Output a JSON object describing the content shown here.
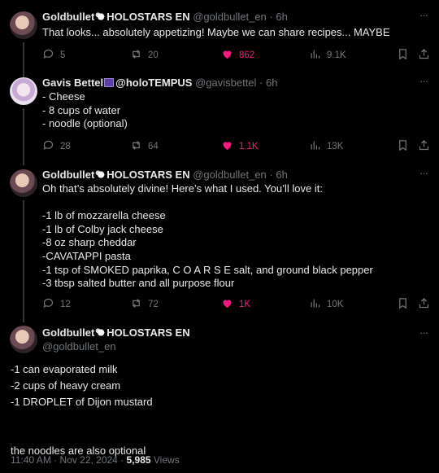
{
  "tweets": [
    {
      "name": "Goldbullet",
      "name_suffix": "HOLOSTARS EN",
      "handle": "@goldbullet_en",
      "time": "6h",
      "text": "That looks... absolutely appetizing! Maybe we can share recipes... MAYBE",
      "replies": "5",
      "retweets": "20",
      "likes": "862",
      "views": "9.1K"
    },
    {
      "name": "Gavis Bettel",
      "name_suffix": "@holoTEMPUS",
      "handle": "@gavisbettel",
      "time": "6h",
      "text": "- Cheese\n- 8 cups of water\n- noodle (optional)",
      "replies": "28",
      "retweets": "64",
      "likes": "1.1K",
      "views": "13K"
    },
    {
      "name": "Goldbullet",
      "name_suffix": "HOLOSTARS EN",
      "handle": "@goldbullet_en",
      "time": "6h",
      "text": "Oh that’s absolutely divine! Here’s what I used. You’ll love it:\n\n-1 lb of mozzarella cheese\n-1 lb of Colby jack cheese\n-8 oz sharp cheddar\n-CAVATAPPI pasta\n-1 tsp of SMOKED paprika, C O A R S E salt, and ground black pepper\n-3 tbsp salted butter and all purpose flour",
      "replies": "12",
      "retweets": "72",
      "likes": "1K",
      "views": "10K"
    }
  ],
  "main": {
    "name": "Goldbullet",
    "name_suffix": "HOLOSTARS EN",
    "handle": "@goldbullet_en",
    "text": "-1 can evaporated milk\n-2 cups of heavy cream\n-1 DROPLET of Dijon mustard\n\n\nthe noodles are also optional",
    "timestamp": "11:40 AM · Nov 22, 2024 · ",
    "views_count": "5,985",
    "views_label": " Views"
  },
  "colors": {
    "background": "#000000",
    "text": "#e7e9ea",
    "muted": "#71767b",
    "like_active": "#f91880"
  },
  "icons": [
    "reply-icon",
    "retweet-icon",
    "like-icon",
    "views-icon",
    "bookmark-icon",
    "share-icon",
    "more-icon"
  ]
}
